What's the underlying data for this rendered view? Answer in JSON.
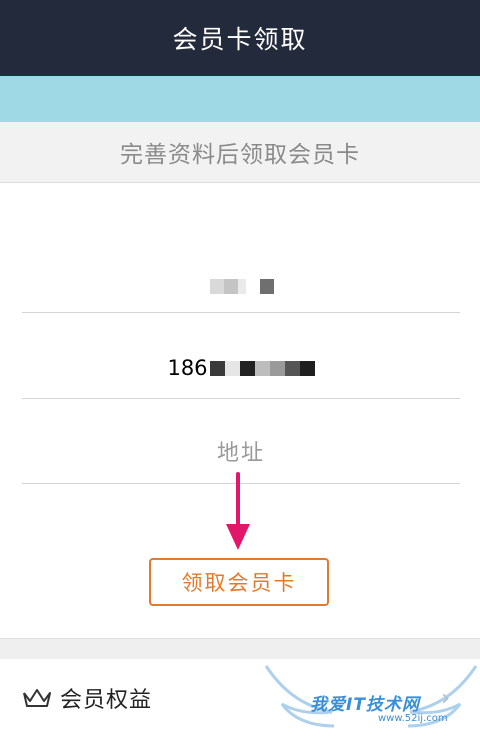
{
  "header": {
    "title": "会员卡领取"
  },
  "subtitle": "完善资料后领取会员卡",
  "form": {
    "name_value": "",
    "phone_prefix": "186",
    "address_placeholder": "地址"
  },
  "claim_button_label": "领取会员卡",
  "benefits": {
    "label": "会员权益",
    "chevron": "›"
  },
  "watermark": {
    "text": "我爱IT技术网",
    "url": "www.52ij.com"
  },
  "colors": {
    "header_bg": "#232a3b",
    "banner": "#9fd9e5",
    "accent": "#e27a2d",
    "arrow": "#e2176a"
  },
  "icons": [
    "crown-icon",
    "chevron-right-icon",
    "arrow-down-icon",
    "wing-logo-icon"
  ]
}
